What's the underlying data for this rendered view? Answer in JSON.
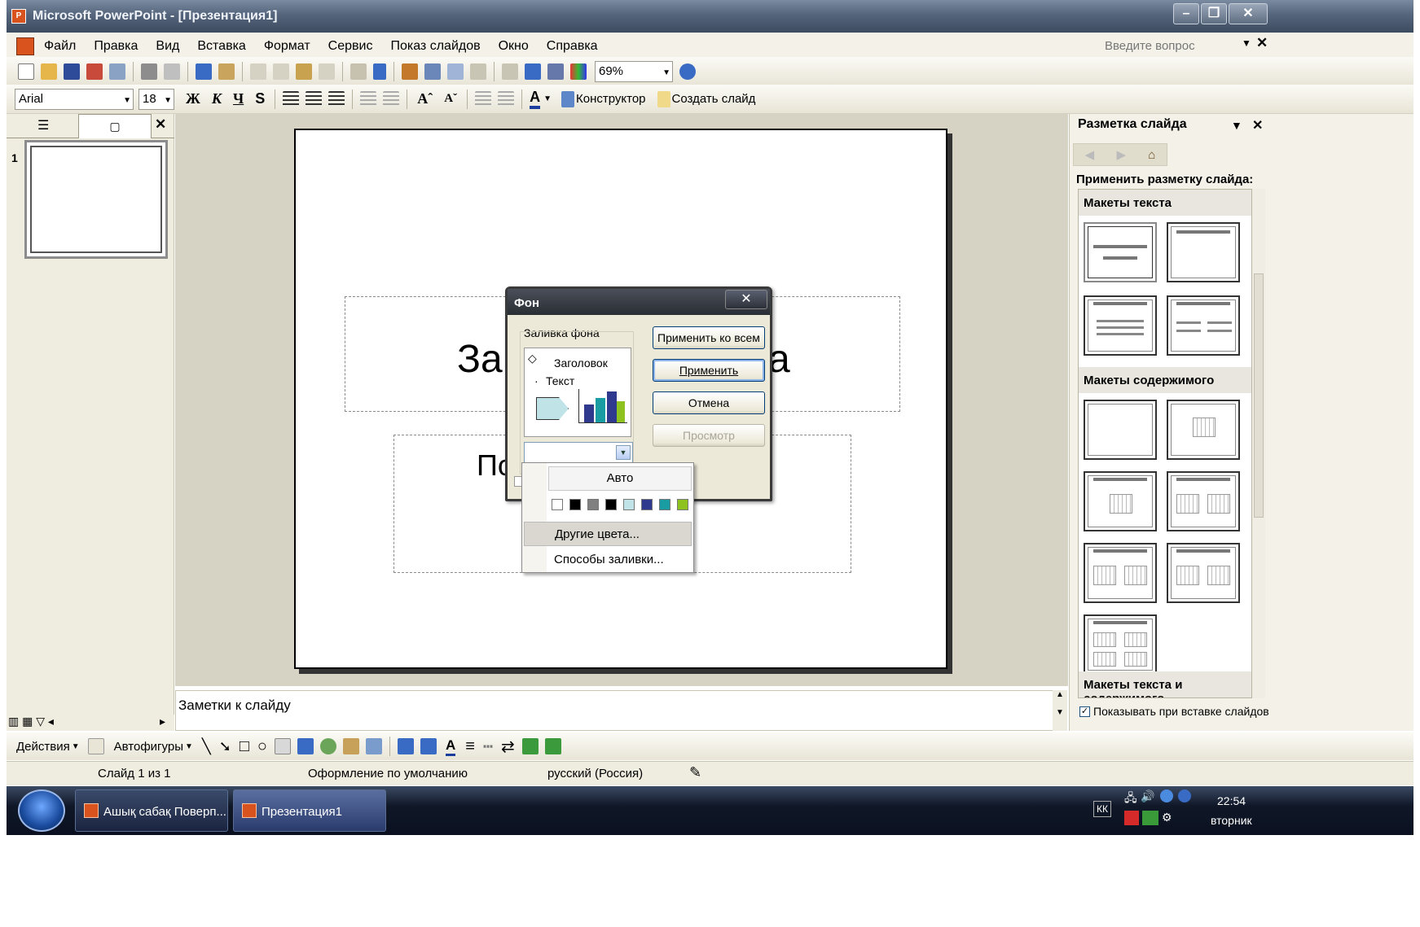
{
  "window": {
    "title": "Microsoft PowerPoint - [Презентация1]"
  },
  "menu": {
    "items": [
      "Файл",
      "Правка",
      "Вид",
      "Вставка",
      "Формат",
      "Сервис",
      "Показ слайдов",
      "Окно",
      "Справка"
    ],
    "ask_placeholder": "Введите вопрос"
  },
  "standard_toolbar": {
    "zoom": "69%"
  },
  "formatting_toolbar": {
    "font": "Arial",
    "size": "18",
    "bold": "Ж",
    "italic": "К",
    "underline": "Ч",
    "shadow": "S",
    "designer": "Конструктор",
    "new_slide": "Создать слайд"
  },
  "left_pane": {
    "slide_number": "1"
  },
  "slide": {
    "title_visible": "За",
    "title_end": "а",
    "subtitle_visible": "По"
  },
  "notes": {
    "placeholder": "Заметки к слайду"
  },
  "drawing_toolbar": {
    "actions": "Действия",
    "autoshapes": "Автофигуры"
  },
  "status": {
    "slide": "Слайд 1 из 1",
    "design": "Оформление по умолчанию",
    "language": "русский (Россия)"
  },
  "task_pane": {
    "title": "Разметка слайда",
    "apply_label": "Применить разметку слайда:",
    "sections": [
      "Макеты текста",
      "Макеты содержимого",
      "Макеты текста и содержимого"
    ],
    "show_on_insert": "Показывать при вставке слайдов"
  },
  "dialog": {
    "title": "Фон",
    "group": "Заливка фона",
    "preview_heading": "Заголовок",
    "preview_text": "Текст",
    "buttons": {
      "apply_all": "Применить ко всем",
      "apply": "Применить",
      "cancel": "Отмена",
      "preview": "Просмотр"
    }
  },
  "color_popup": {
    "auto": "Авто",
    "swatches": [
      "#ffffff",
      "#000000",
      "#808080",
      "#000000",
      "#bfe3e6",
      "#2f3a8f",
      "#1a9ca3",
      "#8dc21f"
    ],
    "more_colors": "Другие цвета...",
    "fill_effects": "Способы заливки..."
  },
  "taskbar": {
    "items": [
      "Ашық сабақ Поверп...",
      "Презентация1"
    ],
    "lang": "КК",
    "time": "22:54",
    "day": "вторник"
  }
}
